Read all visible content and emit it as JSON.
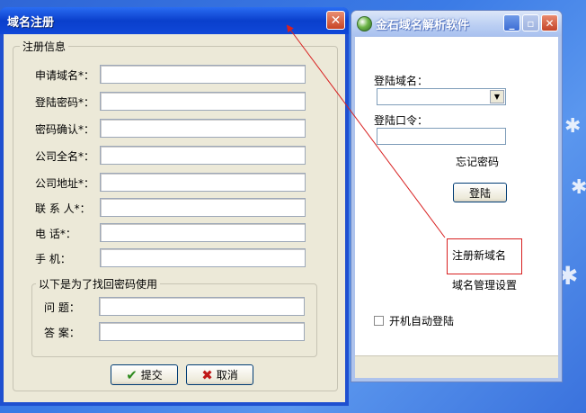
{
  "login_window": {
    "title": "金石域名解析软件",
    "domain_label": "登陆域名：",
    "domain_value": "",
    "password_label": "登陆口令：",
    "password_value": "",
    "forgot_password": "忘记密码",
    "login_button": "登陆",
    "register_link": "注册新域名",
    "manage_link": "域名管理设置",
    "autostart_label": "开机自动登陆",
    "autostart_checked": false
  },
  "register_window": {
    "title": "域名注册",
    "group_title": "注册信息",
    "fields": [
      {
        "label": "申请域名*：",
        "value": ""
      },
      {
        "label": "登陆密码*：",
        "value": ""
      },
      {
        "label": "密码确认*：",
        "value": ""
      },
      {
        "label": "公司全名*：",
        "value": ""
      },
      {
        "label": "公司地址*：",
        "value": ""
      },
      {
        "label": "联 系 人*：",
        "value": ""
      },
      {
        "label": "电    话*：",
        "value": ""
      },
      {
        "label": "手    机：",
        "value": ""
      }
    ],
    "recovery_group_title": "以下是为了找回密码使用",
    "recovery_fields": [
      {
        "label": "问  题：",
        "value": ""
      },
      {
        "label": "答  案：",
        "value": ""
      }
    ],
    "submit_button": "提交",
    "cancel_button": "取消"
  },
  "colors": {
    "annotation": "#d82020",
    "xp_title_active": "#0a3fcc",
    "window_face": "#ece9d8"
  }
}
